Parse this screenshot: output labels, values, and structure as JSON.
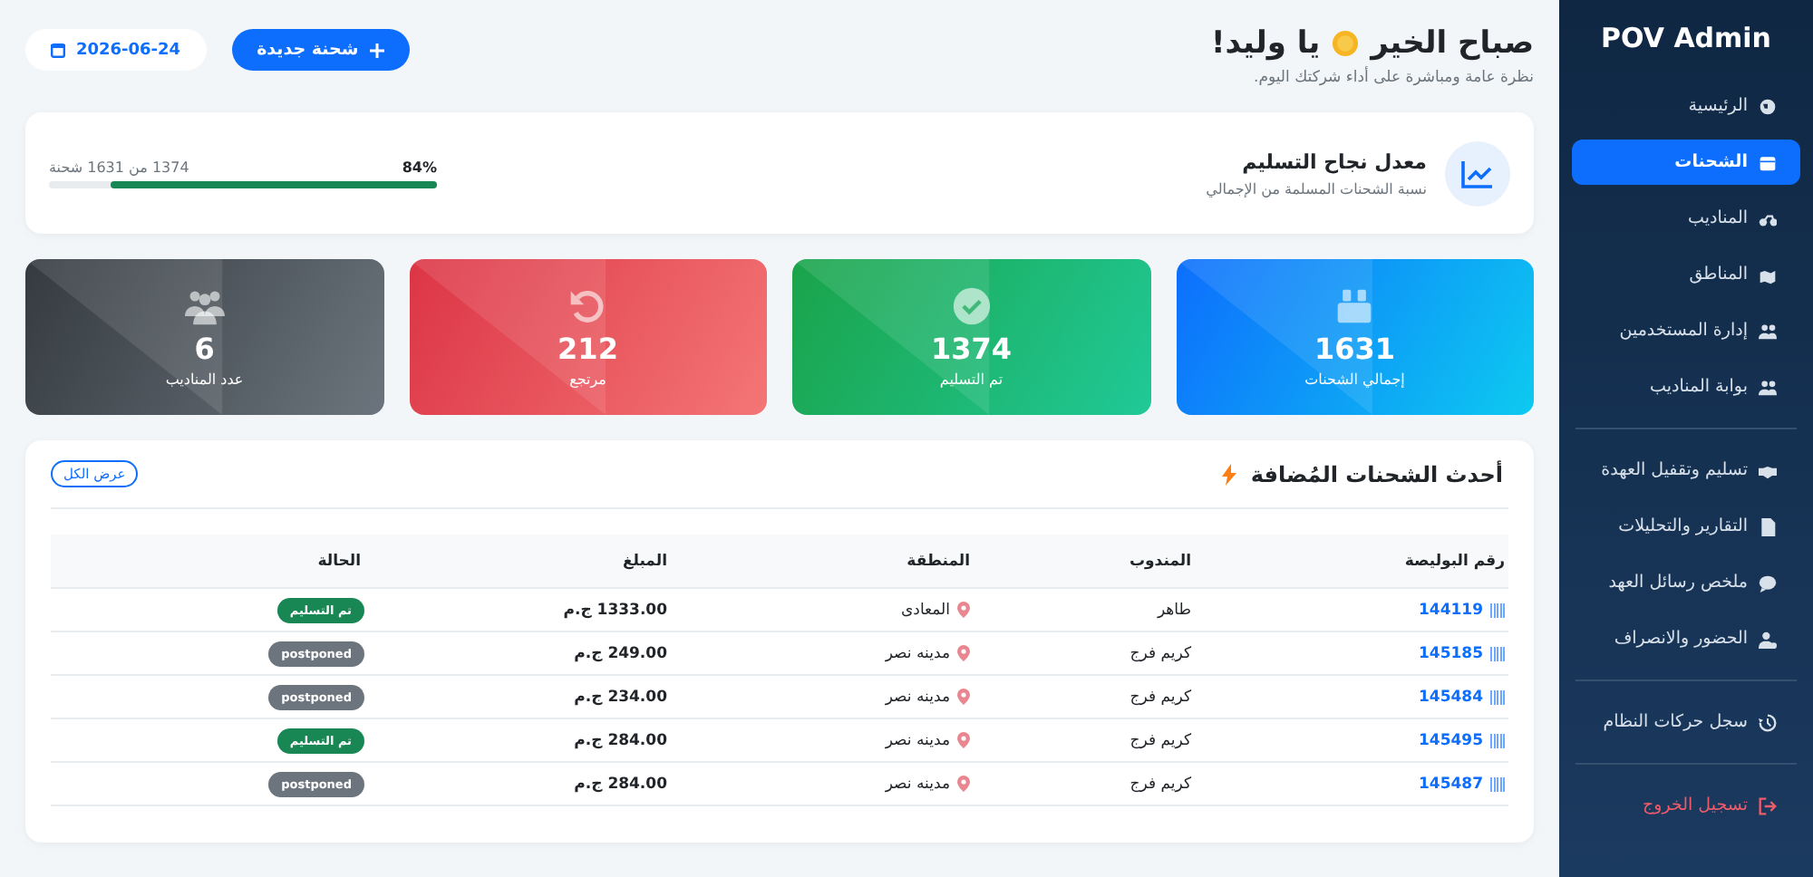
{
  "sidebar": {
    "title": "POV Admin",
    "groups": [
      [
        {
          "label": "الرئيسية",
          "selected": false,
          "kind": "link"
        },
        {
          "label": "الشحنات",
          "selected": true,
          "kind": "link"
        },
        {
          "label": "المناديب",
          "selected": false,
          "kind": "link"
        },
        {
          "label": "المناطق",
          "selected": false,
          "kind": "link"
        },
        {
          "label": "إدارة المستخدمين",
          "selected": false,
          "kind": "link"
        },
        {
          "label": "بوابة المناديب",
          "selected": false,
          "kind": "link"
        }
      ],
      [
        {
          "label": "تسليم وتقفيل العهدة",
          "selected": false,
          "kind": "link"
        },
        {
          "label": "التقارير والتحليلات",
          "selected": false,
          "kind": "link"
        },
        {
          "label": "ملخص رسائل العهد",
          "selected": false,
          "kind": "link"
        },
        {
          "label": "الحضور والانصراف",
          "selected": false,
          "kind": "link"
        }
      ],
      [
        {
          "label": "سجل حركات النظام",
          "selected": false,
          "kind": "link"
        }
      ],
      [
        {
          "label": "تسجيل الخروج",
          "selected": false,
          "kind": "danger"
        }
      ]
    ]
  },
  "header": {
    "greeting": "صباح الخير",
    "name": "يا وليد!",
    "subtitle": "نظرة عامة ومباشرة على أداء شركتك اليوم.",
    "new_button": "شحنة جديدة",
    "date": "2026-06-24"
  },
  "delivery_rate": {
    "title": "معدل نجاح التسليم",
    "subtitle": "نسبة الشحنات المسلمة من الإجمالي",
    "percent": "84%",
    "detail": "1374 من 1631 شحنة",
    "level": 0.84
  },
  "stats": [
    {
      "kind": "total",
      "value": "1631",
      "label": "إجمالي الشحنات"
    },
    {
      "kind": "delivered",
      "value": "1374",
      "label": "تم التسليم"
    },
    {
      "kind": "returned",
      "value": "212",
      "label": "مرتجع"
    },
    {
      "kind": "agents",
      "value": "6",
      "label": "عدد المناديب"
    }
  ],
  "recent": {
    "title": "أحدث الشحنات المُضافة",
    "view_all": "عرض الكل",
    "columns": [
      "رقم البوليصة",
      "المندوب",
      "المنطقة",
      "المبلغ",
      "الحالة"
    ],
    "rows": [
      {
        "waybill": "144119",
        "agent": "طاهر",
        "area": "المعادى",
        "amount": "1333.00 ج.م",
        "status": {
          "label": "تم التسليم",
          "kind": "delivered"
        }
      },
      {
        "waybill": "145185",
        "agent": "كريم فرج",
        "area": "مدينه نصر",
        "amount": "249.00 ج.م",
        "status": {
          "label": "postponed",
          "kind": "postponed"
        }
      },
      {
        "waybill": "145484",
        "agent": "كريم فرج",
        "area": "مدينه نصر",
        "amount": "234.00 ج.م",
        "status": {
          "label": "postponed",
          "kind": "postponed"
        }
      },
      {
        "waybill": "145495",
        "agent": "كريم فرج",
        "area": "مدينه نصر",
        "amount": "284.00 ج.م",
        "status": {
          "label": "تم التسليم",
          "kind": "delivered"
        }
      },
      {
        "waybill": "145487",
        "agent": "كريم فرج",
        "area": "مدينه نصر",
        "amount": "284.00 ج.م",
        "status": {
          "label": "postponed",
          "kind": "postponed"
        }
      }
    ]
  }
}
